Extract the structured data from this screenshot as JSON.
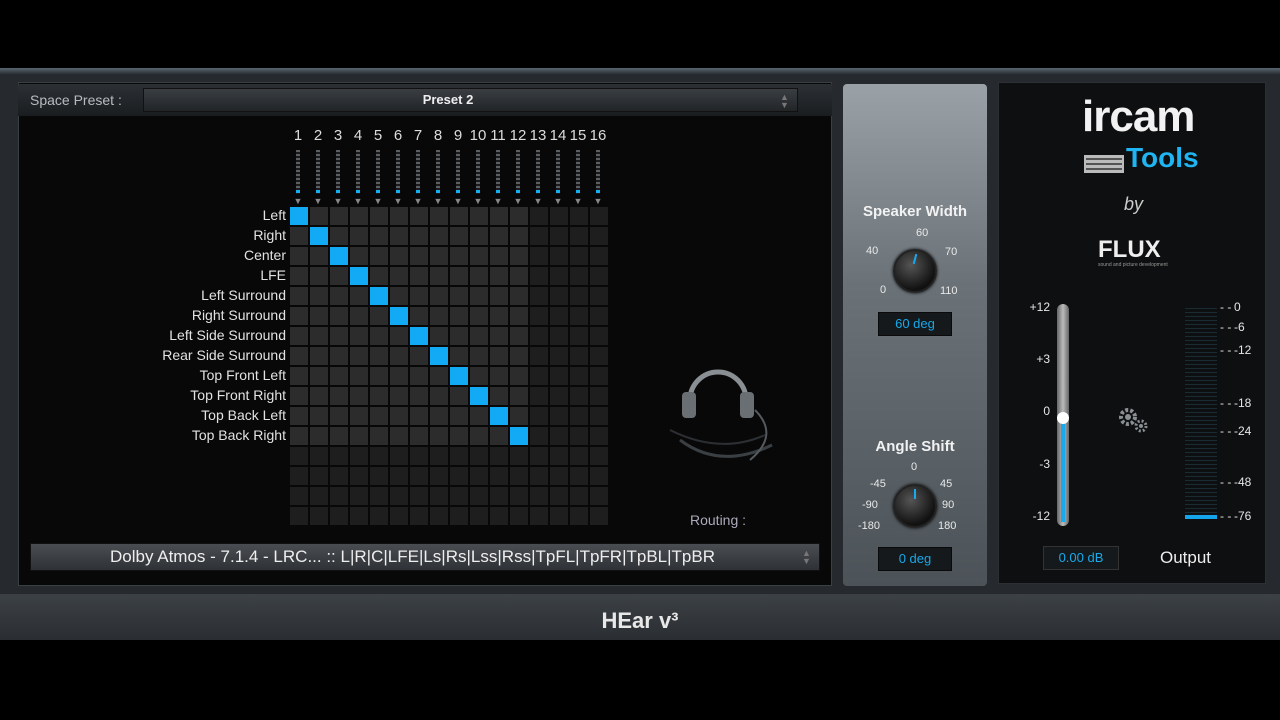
{
  "space_preset": {
    "label": "Space Preset :",
    "value": "Preset 2"
  },
  "columns": [
    "1",
    "2",
    "3",
    "4",
    "5",
    "6",
    "7",
    "8",
    "9",
    "10",
    "11",
    "12",
    "13",
    "14",
    "15",
    "16"
  ],
  "rows": [
    "Left",
    "Right",
    "Center",
    "LFE",
    "Left Surround",
    "Right Surround",
    "Left Side Surround",
    "Rear Side Surround",
    "Top Front Left",
    "Top Front Right",
    "Top Back Left",
    "Top Back Right"
  ],
  "routing_label": "Routing :",
  "format": "Dolby Atmos - 7.1.4 - LRC... :: L|R|C|LFE|Ls|Rs|Lss|Rss|TpFL|TpFR|TpBL|TpBR",
  "speaker_width": {
    "label": "Speaker Width",
    "ticks": [
      "0",
      "40",
      "60",
      "70",
      "110"
    ],
    "value": "60 deg"
  },
  "angle_shift": {
    "label": "Angle Shift",
    "ticks": [
      "-180",
      "-90",
      "-45",
      "0",
      "45",
      "90",
      "180"
    ],
    "value": "0 deg"
  },
  "brand": {
    "ircam": "ircam",
    "tools": "Tools",
    "by": "by",
    "flux": "FLUX",
    "flux_sub": "sound and picture development"
  },
  "gain_scale": [
    "+12",
    "+3",
    "0",
    "-3",
    "-12"
  ],
  "output_scale": [
    "0",
    "-6",
    "-12",
    "-18",
    "-24",
    "-48",
    "-76"
  ],
  "gain_value": "0.00 dB",
  "output_label": "Output",
  "product_title": "HEar v³",
  "accent_color": "#12a9f5"
}
